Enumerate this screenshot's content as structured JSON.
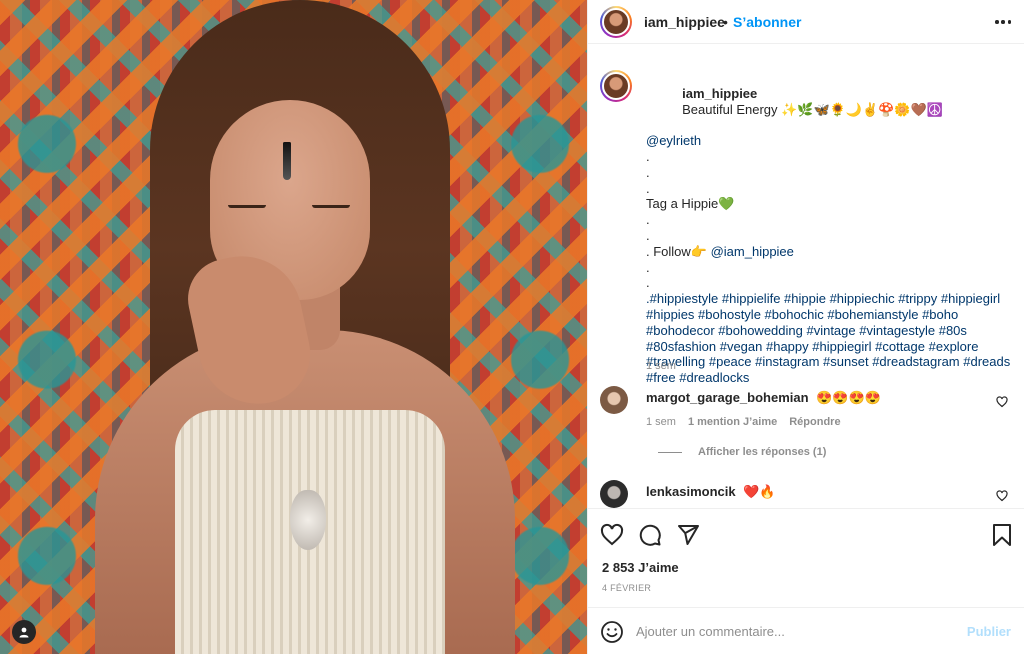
{
  "post": {
    "username": "iam_hippiee",
    "follow_label": "S’abonner",
    "separator": "•"
  },
  "caption": {
    "username": "iam_hippiee",
    "text_intro": "Beautiful Energy ✨🌿🦋🌻🌙✌️🍄🌼🤎☮️",
    "mention": "@eylrieth",
    "dots": [
      ".",
      ".",
      "."
    ],
    "tag_line": "Tag a Hippie💚",
    "dots2": [
      ".",
      "."
    ],
    "follow_line_prefix": ". Follow👉 ",
    "follow_mention": "@iam_hippiee",
    "dots3": [
      ".",
      "."
    ],
    "hashtags": ".#hippiestyle #hippielife #hippie #hippiechic #trippy #hippiegirl #hippies #bohostyle #bohochic #bohemianstyle #boho #bohodecor #bohowedding #vintage #vintagestyle #80s #80sfashion #vegan #happy #hippiegirl #cottage #explore #travelling #peace #instagram #sunset #dreadstagram #dreads #free #dreadlocks",
    "time": "1 sem"
  },
  "comments": [
    {
      "username": "margot_garage_bohemian",
      "text": "😍😍😍😍",
      "time": "1 sem",
      "likes": "1 mention J’aime",
      "reply": "Répondre",
      "replies_label": "Afficher les réponses (1)"
    },
    {
      "username": "lenkasimoncik",
      "text": "❤️🔥"
    }
  ],
  "actions": {
    "likes": "2 853 J’aime",
    "date": "4 FÉVRIER"
  },
  "composer": {
    "placeholder": "Ajouter un commentaire...",
    "publish": "Publier"
  },
  "colors": {
    "link": "#00376b",
    "follow": "#0095f6",
    "publish_disabled": "#b2dffc",
    "muted": "#8e8e8e"
  }
}
